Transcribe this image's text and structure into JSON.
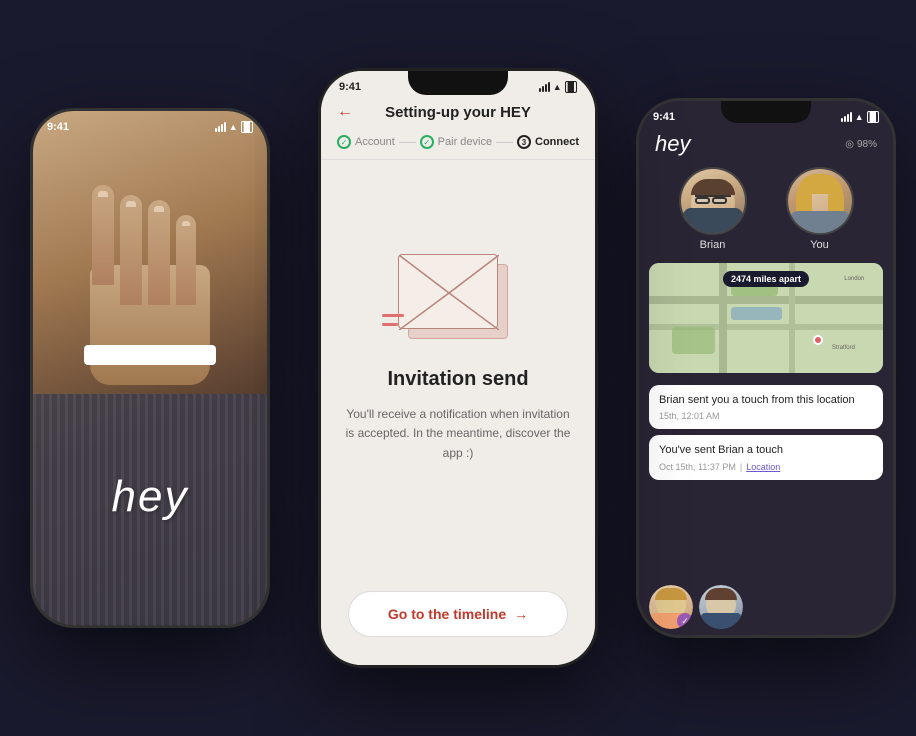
{
  "scene": {
    "bg_color": "#1a1a2e"
  },
  "phone_left": {
    "status_time": "9:41",
    "hey_text": "hey"
  },
  "phone_center": {
    "status_time": "9:41",
    "header_title": "Setting-up your HEY",
    "back_icon": "←",
    "steps": [
      {
        "label": "Account",
        "type": "check"
      },
      {
        "label": "Pair device",
        "type": "check"
      },
      {
        "label": "3. Connect",
        "type": "active"
      }
    ],
    "invitation_title": "Invitation send",
    "invitation_desc": "You'll receive a notification\nwhen invitation is accepted.\nIn the meantime, discover\nthe app :)",
    "timeline_btn_label": "Go to the timeline",
    "timeline_btn_arrow": "→"
  },
  "phone_right": {
    "status_time": "9:41",
    "hey_logo": "hey",
    "battery_label": "98%",
    "battery_icon": "○",
    "brian_label": "Brian",
    "you_label": "You",
    "distance_badge": "2474 miles apart",
    "message1_text": "Brian sent you a touch from this location",
    "message1_date": "15th, 12:01 AM",
    "message2_text": "You've sent Brian a touch",
    "message2_date": "Oct 15th, 11:37 PM",
    "location_link": "Location"
  }
}
